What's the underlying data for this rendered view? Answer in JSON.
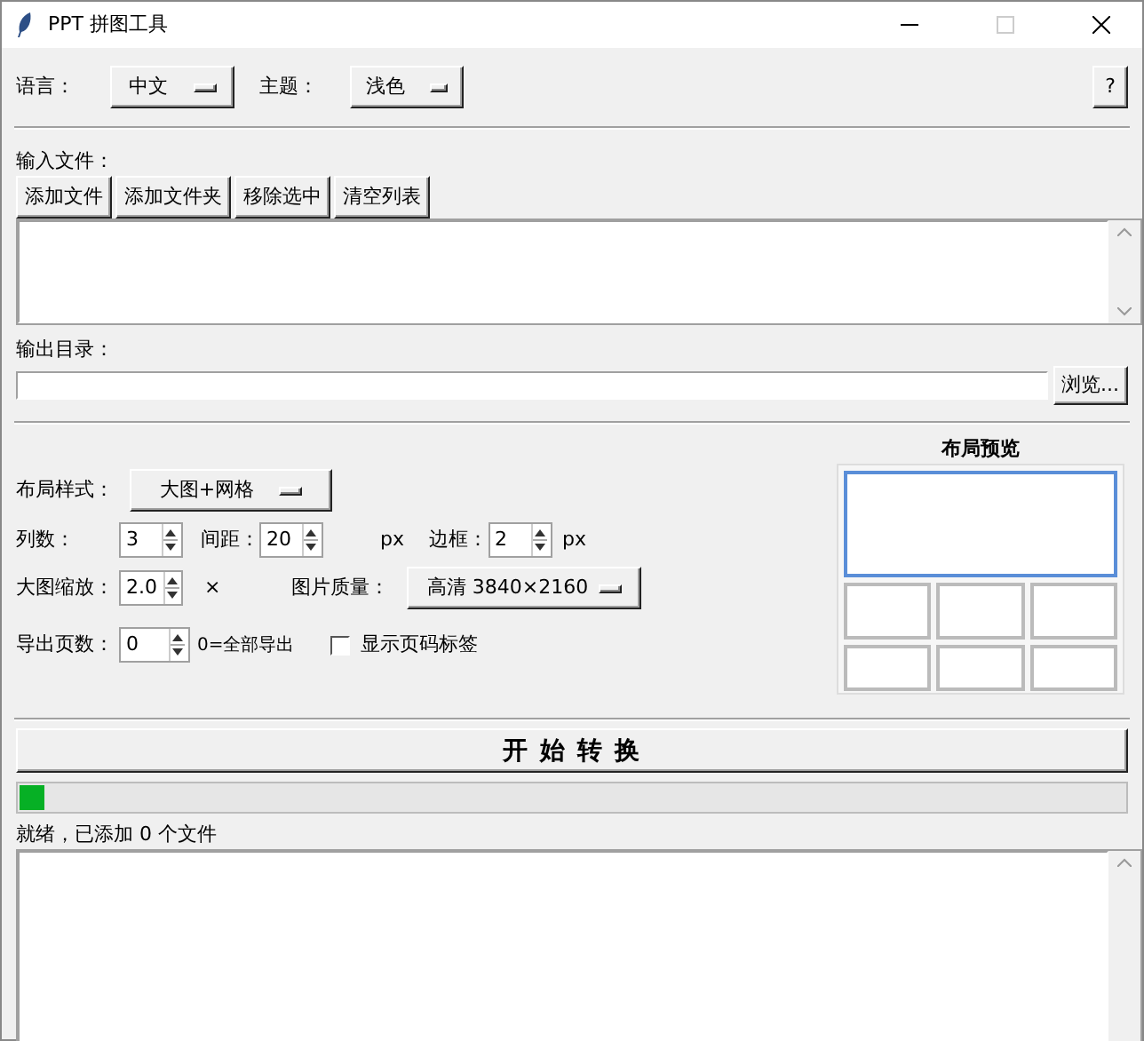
{
  "window": {
    "title": "PPT 拼图工具"
  },
  "toolbar": {
    "language": {
      "label": "语言：",
      "value": "中文"
    },
    "theme": {
      "label": "主题：",
      "value": "浅色"
    },
    "help_button": "?"
  },
  "input": {
    "label": "输入文件：",
    "buttons": [
      "添加文件",
      "添加文件夹",
      "移除选中",
      "清空列表"
    ]
  },
  "output": {
    "label": "输出目录：",
    "browse_button": "浏览..."
  },
  "layout": {
    "style": {
      "label": "布局样式：",
      "value": "大图+网格"
    },
    "columns": {
      "label": "列数：",
      "value": "3"
    },
    "gap": {
      "label": "间距：",
      "value": "20",
      "unit": "px"
    },
    "border": {
      "label": "边框：",
      "value": "2",
      "unit": "px"
    },
    "scale": {
      "label": "大图缩放：",
      "value": "2.0",
      "unit": "×"
    },
    "quality": {
      "label": "图片质量：",
      "value": "高清 3840×2160"
    },
    "pages": {
      "label": "导出页数：",
      "value": "0",
      "hint": "0=全部导出"
    },
    "page_labels": {
      "label": "显示页码标签",
      "checked": false
    }
  },
  "preview": {
    "title": "布局预览"
  },
  "start_button": "开 始 转 换",
  "progress": {
    "level": 0.022
  },
  "status": "就绪，已添加 0 个文件"
}
